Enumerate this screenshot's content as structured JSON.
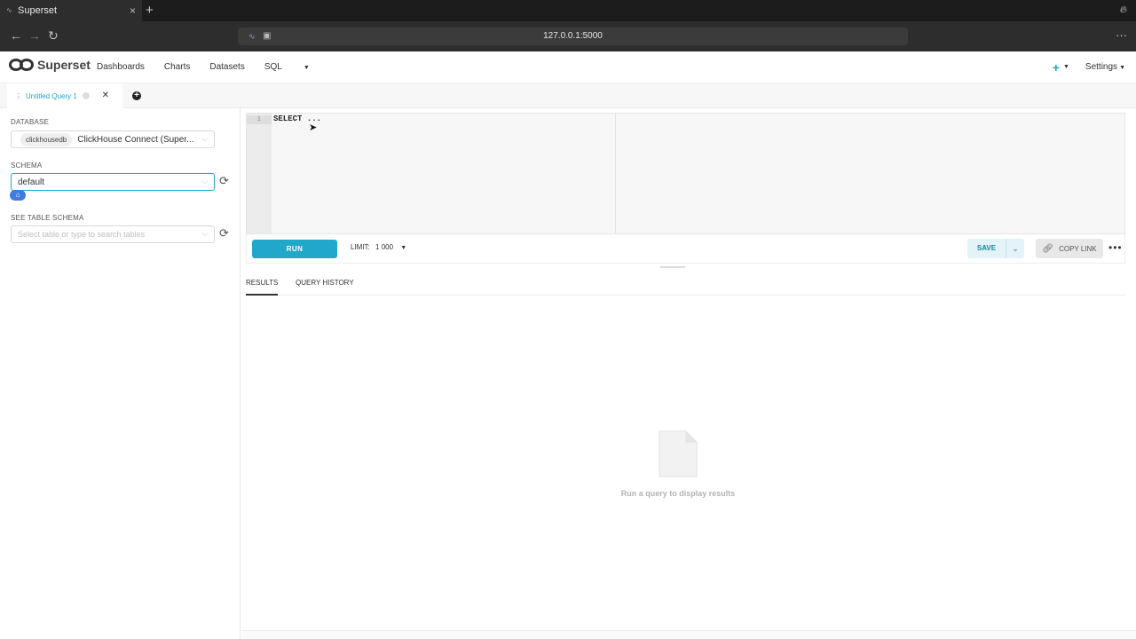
{
  "browser": {
    "tab_title": "Superset",
    "url": "127.0.0.1:5000"
  },
  "header": {
    "logo_text": "Superset",
    "nav": [
      {
        "label": "Dashboards"
      },
      {
        "label": "Charts"
      },
      {
        "label": "Datasets"
      },
      {
        "label": "SQL"
      }
    ],
    "plus_label": "+",
    "settings_label": "Settings"
  },
  "query_tabs": [
    {
      "label": "Untitled Query 1"
    }
  ],
  "sidebar": {
    "database_label": "DATABASE",
    "database_tag": "clickhousedb",
    "database_value": "ClickHouse Connect (Super...",
    "schema_label": "SCHEMA",
    "schema_value": "default",
    "table_schema_label": "SEE TABLE SCHEMA",
    "table_placeholder": "Select table or type to search tables"
  },
  "editor": {
    "line_number": "1",
    "code": "SELECT ..."
  },
  "toolbar": {
    "run_label": "RUN",
    "limit_label": "LIMIT:",
    "limit_value": "1 000",
    "save_label": "SAVE",
    "copy_link_label": "COPY LINK"
  },
  "results": {
    "tabs": [
      {
        "label": "RESULTS"
      },
      {
        "label": "QUERY HISTORY"
      }
    ],
    "empty_message": "Run a query to display results"
  },
  "colors": {
    "accent": "#20a7c9",
    "browser_dark": "#1c1c1c"
  }
}
